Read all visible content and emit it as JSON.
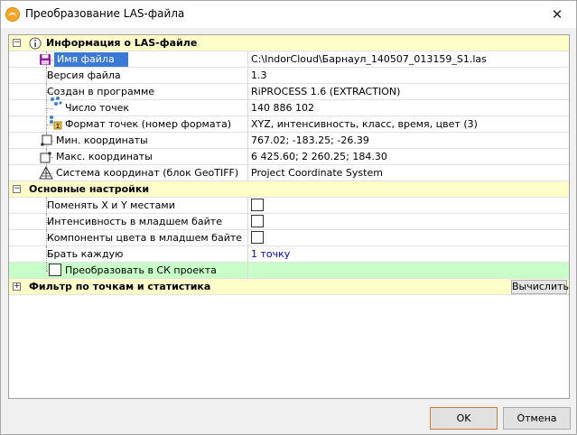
{
  "window": {
    "title": "Преобразование LAS-файла",
    "close_glyph": "✕"
  },
  "sections": {
    "info": {
      "expander": "−",
      "title": "Информация о LAS-файле",
      "rows": [
        {
          "name": "Имя файла",
          "value": "C:\\IndorCloud\\Барнаул_140507_013159_S1.las"
        },
        {
          "name": "Версия файла",
          "value": "1.3"
        },
        {
          "name": "Создан в программе",
          "value": "RiPROCESS 1.6 (EXTRACTION)"
        },
        {
          "name": "Число точек",
          "value": "140 886 102"
        },
        {
          "name": "Формат точек (номер формата)",
          "value": "XYZ, интенсивность, класс, время, цвет (3)"
        },
        {
          "name": "Мин. координаты",
          "value": "767.02; -183.25; -26.39"
        },
        {
          "name": "Макс. координаты",
          "value": "6 425.60; 2 260.25; 184.30"
        },
        {
          "name": "Система координат (блок GeoTIFF)",
          "value": "Project Coordinate System"
        }
      ]
    },
    "settings": {
      "expander": "−",
      "title": "Основные настройки",
      "rows": [
        {
          "name": "Поменять X и Y местами",
          "checked": false
        },
        {
          "name": "Интенсивность в младшем байте",
          "checked": false
        },
        {
          "name": "Компоненты цвета в младшем байте",
          "checked": false
        },
        {
          "name": "Брать каждую",
          "value": "1 точку"
        },
        {
          "name": "Преобразовать в СК проекта",
          "checked": false
        }
      ]
    },
    "filter": {
      "expander": "+",
      "title": "Фильтр по точкам и статистика",
      "button": "Вычислить"
    }
  },
  "buttons": {
    "ok": "OK",
    "cancel": "Отмена"
  },
  "colors": {
    "category_bg": "#fefec8",
    "selected_bg": "#3b79d8",
    "highlight_row_bg": "#c8ffc8",
    "link_value": "#0000c8",
    "app_icon": "#f7a823"
  }
}
